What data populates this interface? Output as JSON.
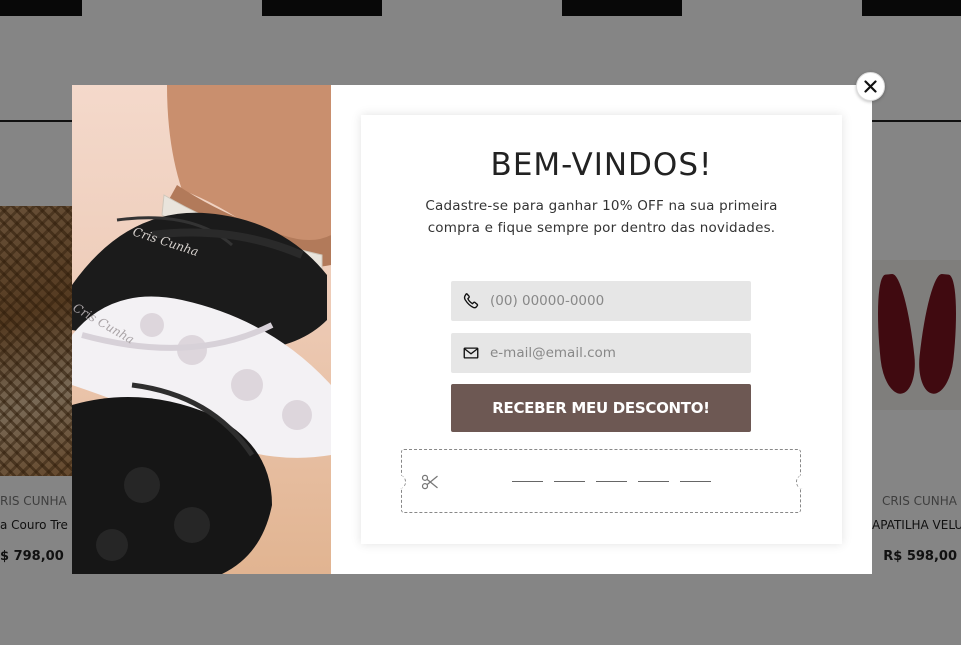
{
  "background": {
    "left_product": {
      "brand": "RIS CUNHA",
      "name": "a Couro Tre",
      "price": "$ 798,00"
    },
    "right_product": {
      "brand": "CRIS CUNHA",
      "name": "APATILHA VELU",
      "price": "R$ 598,00"
    }
  },
  "modal": {
    "title": "BEM-VINDOS!",
    "subtitle": "Cadastre-se para ganhar 10% OFF na sua primeira compra e fique sempre por dentro das novidades.",
    "photo_brand_text": "Cris Cunha",
    "phone_placeholder": "(00) 00000-0000",
    "email_placeholder": "e-mail@email.com",
    "submit_label": "RECEBER MEU DESCONTO!",
    "icons": {
      "phone": "phone-icon",
      "email": "mail-icon",
      "coupon": "scissors-icon",
      "close": "close-icon"
    },
    "colors": {
      "button": "#6d5853",
      "field": "#e6e6e6",
      "overlay": "rgba(0,0,0,0.48)"
    }
  }
}
